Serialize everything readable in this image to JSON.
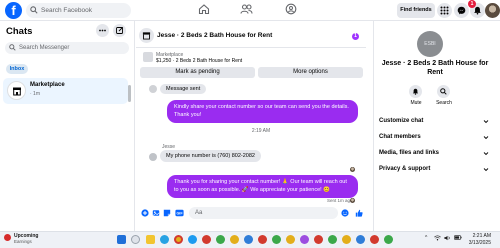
{
  "topbar": {
    "search_placeholder": "Search Facebook",
    "find_friends_label": "Find friends",
    "notification_count": "1"
  },
  "left": {
    "title": "Chats",
    "search_placeholder": "Search Messenger",
    "filter_tab": "Inbox",
    "conversations": [
      {
        "name": "Marketplace",
        "time": "· 1m"
      }
    ]
  },
  "chat": {
    "title": "Jesse · 2 Beds 2 Bath House for Rent",
    "badge": "1",
    "listing_label": "Marketplace",
    "listing_price": "$1,250 · 2 Beds 2 Bath House for Rent",
    "mark_pending_label": "Mark as pending",
    "more_options_label": "More options",
    "system_message": "Message sent",
    "messages": [
      {
        "text": "Kindly share your contact number so our team can send you the details. Thank you!"
      },
      {
        "text": "Thank you for sharing your contact number! 🙏 Our team will reach out to you as soon as possible. 🚀 We appreciate your patience! 😊"
      }
    ],
    "time_divider": "2:19 AM",
    "sender_name": "Jesse",
    "incoming_message": "My phone number is (760) 802-2082",
    "sent_status": "Sent 1m ago",
    "composer_placeholder": "Aa"
  },
  "right": {
    "avatar_text": "ESBI",
    "title": "Jesse · 2 Beds 2 Bath House for Rent",
    "mute_label": "Mute",
    "search_label": "Search",
    "sections": [
      "Customize chat",
      "Chat members",
      "Media, files and links",
      "Privacy & support"
    ]
  },
  "taskbar": {
    "weather_title": "Upcoming",
    "weather_sub": "Earnings",
    "time": "2:21 AM",
    "date": "3/13/2025"
  },
  "colors": {
    "brand": "#0866ff",
    "bubble_out": "#9a2cf0",
    "accent_blue": "#0064d1"
  }
}
